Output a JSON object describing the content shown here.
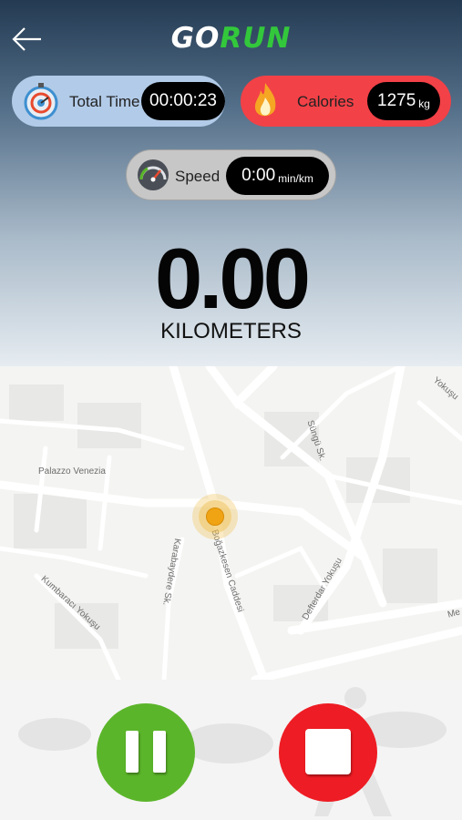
{
  "header": {
    "back_icon": "arrow-left-icon",
    "logo_part1": "GO",
    "logo_part2": "RUN",
    "colors": {
      "logo_go": "#ffffff",
      "logo_run": "#33c83c"
    }
  },
  "stats": {
    "total_time": {
      "label": "Total Time",
      "value": "00:00:23",
      "icon": "stopwatch-icon",
      "color": "#b2cbe8"
    },
    "calories": {
      "label": "Calories",
      "value": "1275",
      "unit": "kg",
      "icon": "flame-icon",
      "color": "#f24147"
    },
    "speed": {
      "label": "Speed",
      "value": "0:00",
      "unit": "min/km",
      "icon": "speedometer-icon",
      "color": "#c7c7c7"
    }
  },
  "distance": {
    "value": "0.00",
    "unit": "KILOMETERS"
  },
  "map": {
    "streets": {
      "palazzo": "Palazzo Venezia",
      "sungu": "Süngü Sk.",
      "kumbaraci": "Kumbaracı Yokuşu",
      "karabaydere": "Karabaydere Sk.",
      "bogazkesen": "Boğazkesen Caddesi",
      "defterdar": "Defterdar Yokuşu",
      "yokusu_top": "Yokuşu",
      "me": "Me"
    },
    "marker_icon": "location-marker-icon"
  },
  "controls": {
    "pause_icon": "pause-icon",
    "stop_icon": "stop-icon",
    "colors": {
      "pause": "#5bb52a",
      "stop": "#ee1c24"
    }
  }
}
